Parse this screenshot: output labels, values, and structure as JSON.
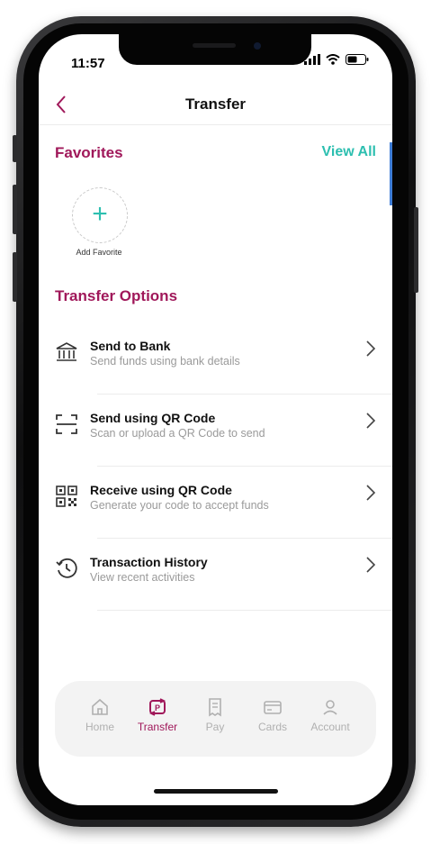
{
  "status_bar": {
    "time": "11:57"
  },
  "header": {
    "title": "Transfer",
    "back_icon": "chevron-left-icon"
  },
  "favorites": {
    "title": "Favorites",
    "view_all": "View All",
    "add_label": "Add Favorite"
  },
  "transfer_options": {
    "title": "Transfer Options",
    "items": [
      {
        "label": "Send to Bank",
        "sub": "Send funds using bank details",
        "icon": "bank-icon"
      },
      {
        "label": "Send using QR Code",
        "sub": "Scan or upload a  QR Code to send",
        "icon": "qr-scan-icon"
      },
      {
        "label": "Receive using QR Code",
        "sub": "Generate your code to accept funds",
        "icon": "qr-code-icon"
      },
      {
        "label": "Transaction History",
        "sub": "View recent activities",
        "icon": "history-icon"
      }
    ]
  },
  "tabbar": {
    "items": [
      {
        "label": "Home",
        "icon": "home-icon"
      },
      {
        "label": "Transfer",
        "icon": "transfer-icon"
      },
      {
        "label": "Pay",
        "icon": "receipt-icon"
      },
      {
        "label": "Cards",
        "icon": "card-icon"
      },
      {
        "label": "Account",
        "icon": "person-icon"
      }
    ],
    "active": "Transfer"
  },
  "colors": {
    "brand": "#a0185a",
    "accent": "#2dbfb0"
  }
}
